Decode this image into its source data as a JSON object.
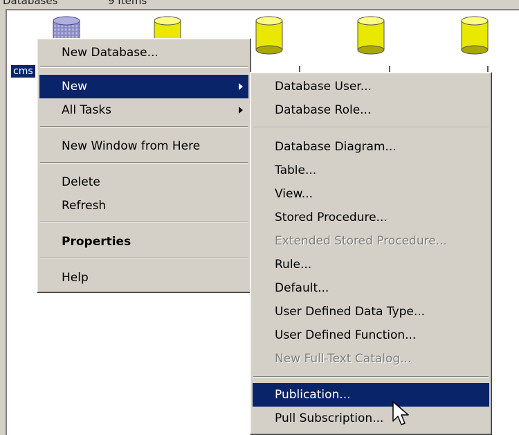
{
  "header": {
    "left_text": "Databases",
    "right_text": "9 Items"
  },
  "list": {
    "selected_label": "cms",
    "partial_labels": [
      "l",
      "l",
      "l"
    ]
  },
  "context_menu": {
    "new_database": "New Database...",
    "new": "New",
    "all_tasks": "All Tasks",
    "new_window": "New Window from Here",
    "delete": "Delete",
    "refresh": "Refresh",
    "properties": "Properties",
    "help": "Help"
  },
  "submenu": {
    "database_user": "Database User...",
    "database_role": "Database Role...",
    "database_diagram": "Database Diagram...",
    "table": "Table...",
    "view": "View...",
    "stored_procedure": "Stored Procedure...",
    "extended_stored_procedure": "Extended Stored Procedure...",
    "rule": "Rule...",
    "default": "Default...",
    "user_defined_data_type": "User Defined Data Type...",
    "user_defined_function": "User Defined Function...",
    "new_fulltext_catalog": "New Full-Text Catalog...",
    "publication": "Publication...",
    "pull_subscription": "Pull Subscription..."
  },
  "colors": {
    "selection": "#0a246a",
    "menu_bg": "#d4d0c8",
    "db_icon_yellow": "#e8e800",
    "db_icon_selected": "#8a8ac8"
  }
}
